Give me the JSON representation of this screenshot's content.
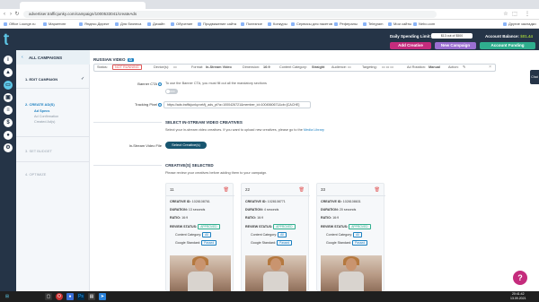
{
  "browser": {
    "tabs": [
      {
        "label": "Office Lounge.ru"
      },
      {
        "label": "Маркетинг"
      },
      {
        "label": "Яндекс.Директ"
      },
      {
        "label": "Для бизнеса"
      },
      {
        "label": "Дизайн"
      },
      {
        "label": "Обучение"
      },
      {
        "label": "Продвижение сайта"
      },
      {
        "label": "Полезное"
      },
      {
        "label": "Конкуры"
      },
      {
        "label": "Сервисы для пакетов"
      },
      {
        "label": "Рефералы"
      },
      {
        "label": "Telegram"
      },
      {
        "label": "Мои сайты"
      },
      {
        "label": "Nebo.com"
      },
      {
        "label": "Другие закладки"
      }
    ],
    "url": "advertiser.trafficjunky.com/campaign/1000533041/createAds"
  },
  "header": {
    "spend_label": "Daily Spending Limit:",
    "spend_value": "$13 out of $500",
    "balance_label": "Account Balance:",
    "balance_value": "$01.44",
    "buttons": {
      "add_creative": "Add Creative",
      "new_campaign": "New Campaign",
      "account_funding": "Account Funding"
    },
    "colors": {
      "add_creative": "#c52c7d",
      "new_campaign": "#9b6fd1",
      "account_funding": "#2fae8e"
    }
  },
  "steps": {
    "all_campaigns": "ALL CAMPAIGNS",
    "step1": "1. EDIT CAMPAIGN",
    "step2": "2. CREATE AD(S)",
    "step2_sub": [
      "Ad Specs",
      "Ad Confirmation",
      "Created Ad(s)"
    ],
    "step3": "3. SET BUDGET",
    "step4": "4. OPTIMIZE"
  },
  "summary": {
    "title": "RUSSIAN VIDEO",
    "badge": "ID",
    "status_label": "Status:",
    "status_value": "NOT RUNNING",
    "device_label": "Device(s):",
    "format_label": "Format:",
    "format_value": "In-Stream Video",
    "dimension_label": "Dimension:",
    "dimension_value": "16:9",
    "content_cat_label": "Content Category:",
    "content_cat_value": "Straight",
    "audience_label": "Audience:",
    "targeting_label": "Targeting:",
    "ad_rotation_label": "Ad Rotation:",
    "ad_rotation_value": "Manual",
    "action_label": "Action:"
  },
  "banner_cta": {
    "label": "Banner CTA",
    "desc": "To use the Banner CTA, you must fill out all the mandatory sections",
    "toggle_text": "OFF"
  },
  "tracking": {
    "label": "Tracking Pixel",
    "value": "https://ads.trafficjunky.net/tj_ads_pt?a=1000426721&member_id=1004560671&cb=[CACHE]"
  },
  "select_section": {
    "title": "SELECT IN-STREAM VIDEO CREATIVES",
    "desc_pre": "Select your in-stream video creatives. If you want to upload new creatives, please go to the",
    "desc_link": "Media Library",
    "file_label": "In-Stream Video File",
    "button": "Select Creative(s)"
  },
  "selected_section": {
    "title": "CREATIVE(S) SELECTED",
    "desc": "Please review your creatives before adding them to your campaign."
  },
  "cards": [
    {
      "idx": "11",
      "creative_id": "1028108761",
      "duration": "13 seconds",
      "ratio": "16:9",
      "review_status": "APPROVED",
      "content_category": "All",
      "google_standard": "Passed"
    },
    {
      "idx": "22",
      "creative_id": "1028108771",
      "duration": "4 seconds",
      "ratio": "16:9",
      "review_status": "APPROVED",
      "content_category": "All",
      "google_standard": "Passed"
    },
    {
      "idx": "33",
      "creative_id": "1028108631",
      "duration": "20 seconds",
      "ratio": "16:9",
      "review_status": "APPROVED",
      "content_category": "All",
      "google_standard": "Passed"
    }
  ],
  "card_labels": {
    "creative_id": "CREATIVE ID:",
    "duration": "DURATION:",
    "ratio": "RATIO:",
    "review_status": "REVIEW STATUS:",
    "content_category": "Content Category:",
    "google_standard": "Google Standard:"
  },
  "chat_tab": "Chat",
  "help": "?",
  "taskbar": {
    "time": "20:41:42",
    "date": "13.09.2021"
  }
}
